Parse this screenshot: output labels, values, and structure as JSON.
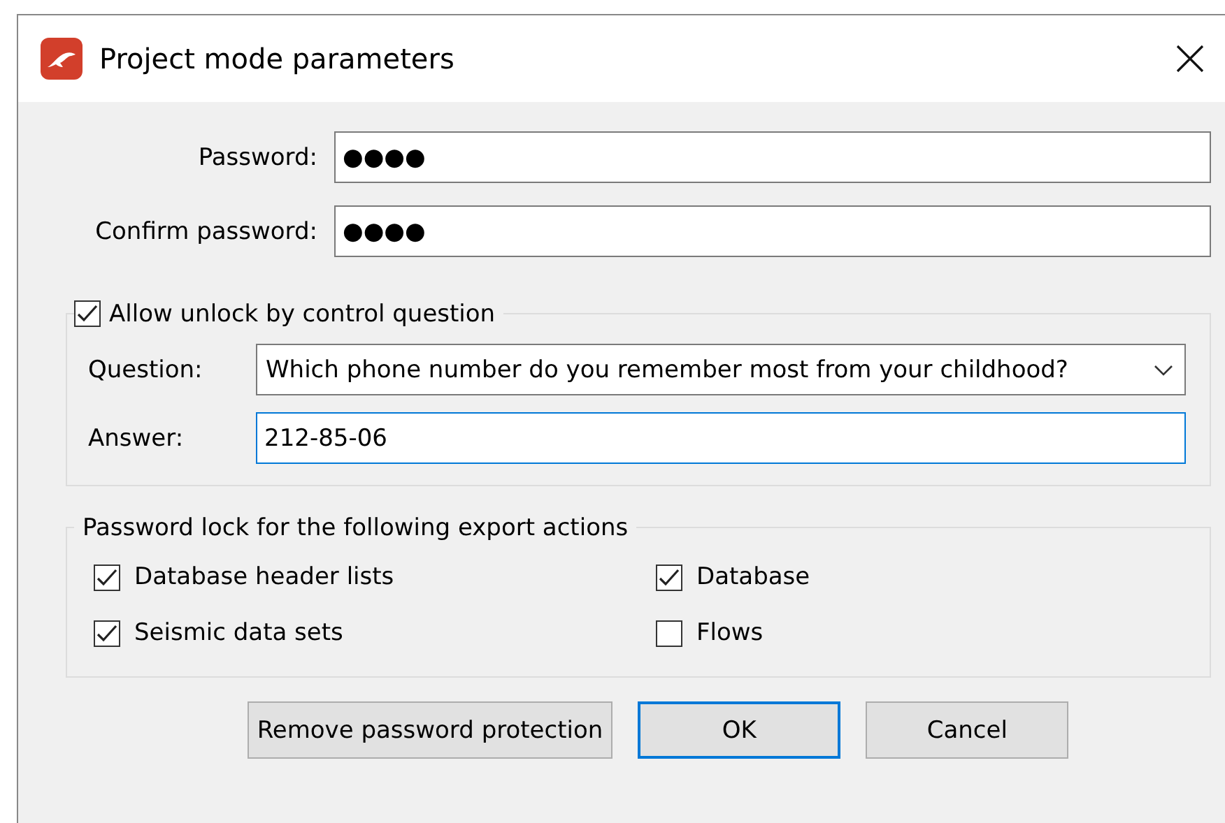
{
  "window": {
    "title": "Project mode parameters"
  },
  "password": {
    "label": "Password:",
    "value": "●●●●"
  },
  "confirm_password": {
    "label": "Confirm password:",
    "value": "●●●●"
  },
  "unlock_group": {
    "label": "Allow unlock by control question",
    "checked": true,
    "question": {
      "label": "Question:",
      "value": "Which phone number do you remember most from your childhood?"
    },
    "answer": {
      "label": "Answer:",
      "value": "212-85-06",
      "focused": true
    }
  },
  "export_group": {
    "title": "Password lock for the following export actions",
    "options": [
      {
        "label": "Database header lists",
        "checked": true
      },
      {
        "label": "Database",
        "checked": true
      },
      {
        "label": "Seismic data sets",
        "checked": true
      },
      {
        "label": "Flows",
        "checked": false
      }
    ]
  },
  "buttons": [
    {
      "label": "Remove password protection",
      "default": false
    },
    {
      "label": "OK",
      "default": true
    },
    {
      "label": "Cancel",
      "default": false
    }
  ]
}
